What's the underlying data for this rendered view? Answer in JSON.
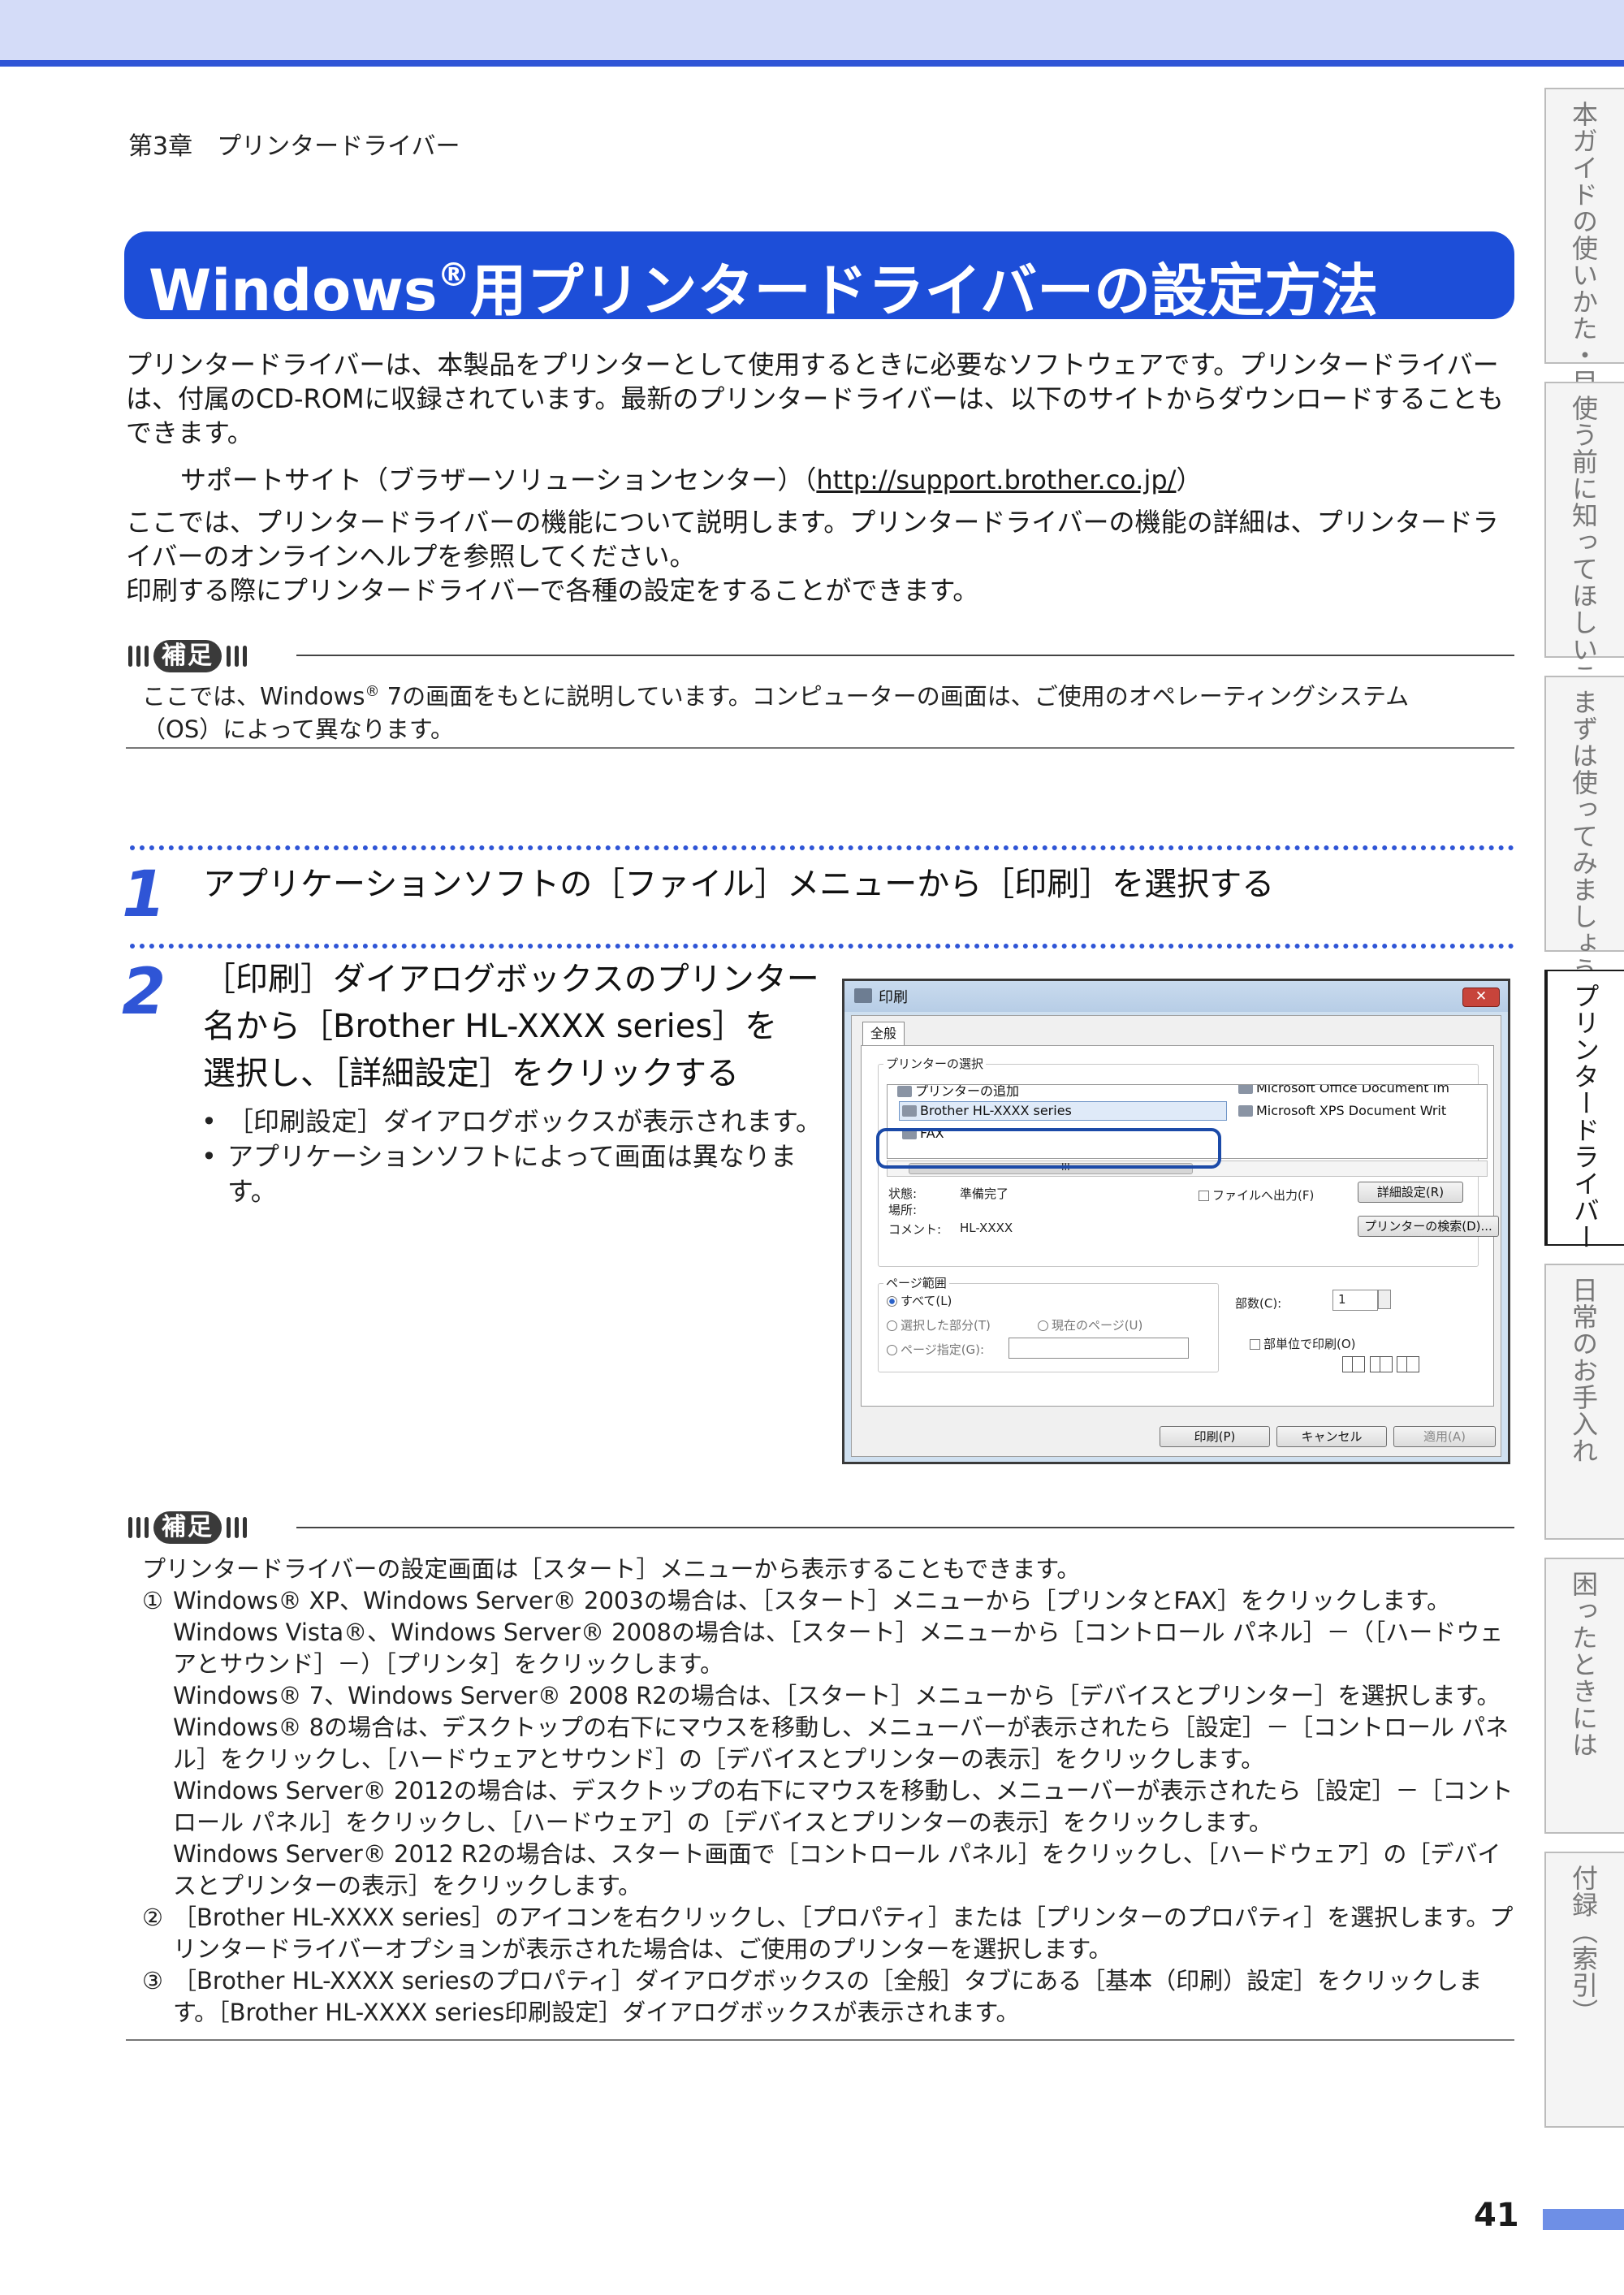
{
  "header": {
    "chapter": "第3章　プリンタードライバー"
  },
  "title": {
    "main": "Windows",
    "reg": "®",
    "rest": "用プリンタードライバーの設定方法"
  },
  "intro": {
    "p1": "プリンタードライバーは、本製品をプリンターとして使用するときに必要なソフトウェアです。プリンタードライバーは、付属のCD-ROMに収録されています。最新のプリンタードライバーは、以下のサイトからダウンロードすることもできます。",
    "support_prefix": "サポートサイト（ブラザーソリューションセンター）（",
    "support_url": "http://support.brother.co.jp/",
    "support_suffix": "）",
    "p2": "ここでは、プリンタードライバーの機能について説明します。プリンタードライバーの機能の詳細は、プリンタードライバーのオンラインヘルプを参照してください。",
    "p3": "印刷する際にプリンタードライバーで各種の設定をすることができます。"
  },
  "note1": {
    "badge": "補足",
    "line1_a": "ここでは、Windows",
    "line1_reg": "®",
    "line1_b": " 7の画面をもとに説明しています。コンピューターの画面は、ご使用のオペレーティングシステム",
    "line2": "（OS）によって異なります。"
  },
  "step1": {
    "num": "1",
    "text": "アプリケーションソフトの［ファイル］メニューから［印刷］を選択する"
  },
  "step2": {
    "num": "2",
    "line1": "［印刷］ダイアログボックスのプリンター",
    "line2": "名から［Brother HL-XXXX series］を",
    "line3": "選択し、［詳細設定］をクリックする",
    "bullet1": "［印刷設定］ダイアログボックスが表示されます。",
    "bullet2": "アプリケーションソフトによって画面は異なります。"
  },
  "dialog": {
    "title": "印刷",
    "close": "✕",
    "tab": "全般",
    "group_select": "プリンターの選択",
    "printer_add": "プリンターの追加",
    "printer_brother": "Brother HL-XXXX series",
    "printer_fax": "FAX",
    "printer_office": "Microsoft Office Document Im",
    "printer_xps": "Microsoft XPS Document Writ",
    "scroll_mark": "III",
    "status_label": "状態:",
    "status_value": "準備完了",
    "location_label": "場所:",
    "comment_label": "コメント:",
    "comment_value": "HL-XXXX",
    "print_to_file": "ファイルへ出力(F)",
    "detail_button": "詳細設定(R)",
    "find_button": "プリンターの検索(D)...",
    "group_range": "ページ範囲",
    "range_all": "すべて(L)",
    "range_selection": "選択した部分(T)",
    "range_current": "現在のページ(U)",
    "range_pages": "ページ指定(G):",
    "copies_label": "部数(C):",
    "copies_value": "1",
    "collate": "部単位で印刷(O)",
    "print_button": "印刷(P)",
    "cancel_button": "キャンセル",
    "apply_button": "適用(A)"
  },
  "note2": {
    "badge": "補足",
    "intro": "プリンタードライバーの設定画面は［スタート］メニューから表示することもできます。",
    "i1_num": "①",
    "i1_l1": "Windows® XP、Windows Server® 2003の場合は、［スタート］メニューから［プリンタとFAX］をクリックします。",
    "i1_l2": "Windows Vista®、Windows Server® 2008の場合は、［スタート］メニューから［コントロール パネル］－（［ハードウェアとサウンド］－）［プリンタ］をクリックします。",
    "i1_l3": "Windows® 7、Windows Server® 2008 R2の場合は、［スタート］メニューから［デバイスとプリンター］を選択します。",
    "i1_l4": "Windows® 8の場合は、デスクトップの右下にマウスを移動し、メニューバーが表示されたら［設定］－［コントロール パネル］をクリックし、［ハードウェアとサウンド］の［デバイスとプリンターの表示］をクリックします。",
    "i1_l5": "Windows Server® 2012の場合は、デスクトップの右下にマウスを移動し、メニューバーが表示されたら［設定］－［コントロール パネル］をクリックし、［ハードウェア］の［デバイスとプリンターの表示］をクリックします。",
    "i1_l6": "Windows Server® 2012 R2の場合は、スタート画面で［コントロール パネル］をクリックし、［ハードウェア］の［デバイスとプリンターの表示］をクリックします。",
    "i2_num": "②",
    "i2": "［Brother HL-XXXX series］のアイコンを右クリックし、［プロパティ］または［プリンターのプロパティ］を選択します。プリンタードライバーオプションが表示された場合は、ご使用のプリンターを選択します。",
    "i3_num": "③",
    "i3": "［Brother HL-XXXX seriesのプロパティ］ダイアログボックスの［全般］タブにある［基本（印刷）設定］をクリックします。［Brother HL-XXXX series印刷設定］ダイアログボックスが表示されます。"
  },
  "sidebar": {
    "tabs": [
      {
        "label": "本ガイドの使いかた・目次"
      },
      {
        "label": "使う前に知ってほしいこと"
      },
      {
        "label": "まずは使ってみましょう"
      },
      {
        "label": "プリンタードライバー"
      },
      {
        "label": "日常のお手入れ"
      },
      {
        "label": "困ったときには"
      },
      {
        "label": "付録（索引）"
      }
    ]
  },
  "footer": {
    "page": "41"
  }
}
